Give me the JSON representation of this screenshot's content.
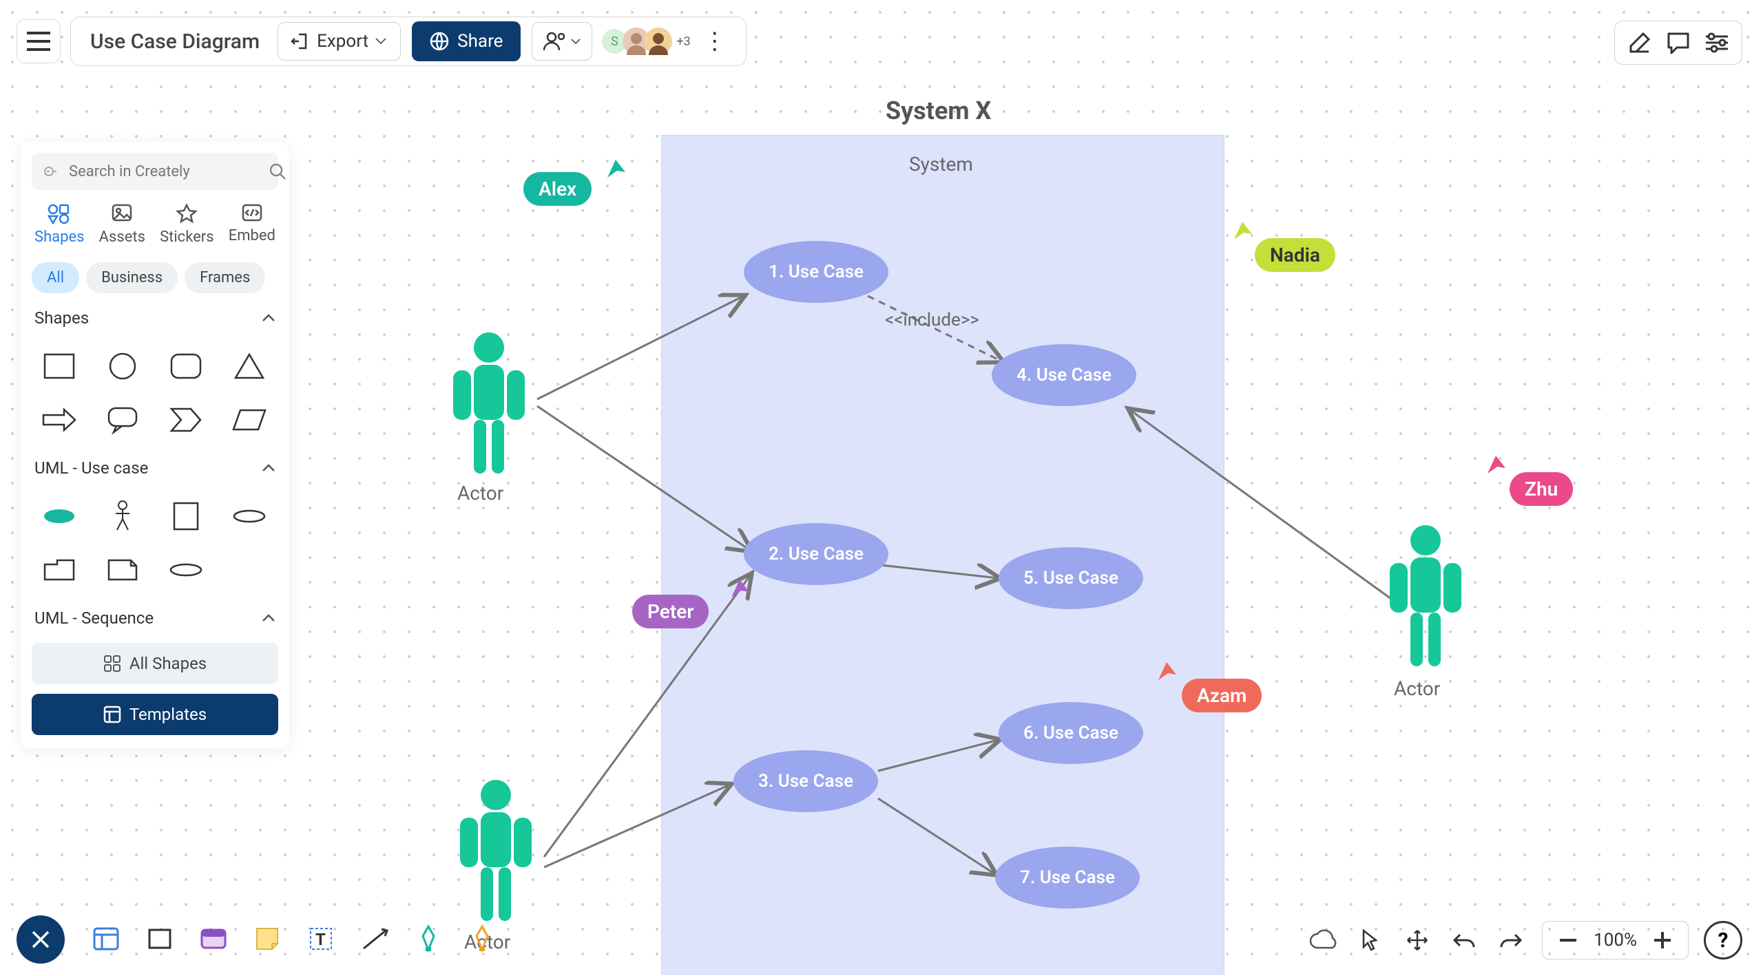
{
  "header": {
    "doc_title": "Use Case Diagram",
    "export_label": "Export",
    "share_label": "Share",
    "avatar_more": "+3"
  },
  "sidebar": {
    "search_placeholder": "Search in Creately",
    "tabs": [
      "Shapes",
      "Assets",
      "Stickers",
      "Embed"
    ],
    "filters": [
      "All",
      "Business",
      "Frames"
    ],
    "sections": {
      "shapes": "Shapes",
      "uml_usecase": "UML - Use case",
      "uml_sequence": "UML - Sequence"
    },
    "all_shapes": "All Shapes",
    "templates": "Templates"
  },
  "diagram": {
    "system_name": "System X",
    "system_label": "System",
    "actors": [
      "Actor",
      "Actor",
      "Actor"
    ],
    "usecases": [
      "1. Use Case",
      "2. Use Case",
      "3. Use Case",
      "4. Use Case",
      "5. Use Case",
      "6. Use Case",
      "7. Use Case"
    ],
    "include_label": "<<include>>"
  },
  "cursors": {
    "alex": {
      "label": "Alex",
      "color": "#16b7a0"
    },
    "nadia": {
      "label": "Nadia",
      "color": "#c4de3a"
    },
    "zhu": {
      "label": "Zhu",
      "color": "#ea4a89"
    },
    "azam": {
      "label": "Azam",
      "color": "#f06a5a"
    },
    "peter": {
      "label": "Peter",
      "color": "#a665c5"
    }
  },
  "bottom": {
    "zoom": "100%"
  }
}
